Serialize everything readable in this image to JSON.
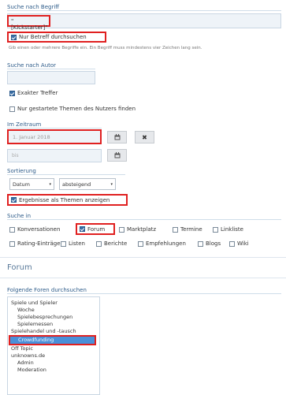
{
  "search": {
    "term_label": "Suche nach Begriff",
    "term_value": "\"[Kickstarter]\"",
    "title_only_label": "Nur Betreff durchsuchen",
    "hint": "Gib einen oder mehrere Begriffe ein. Ein Begriff muss mindestens vier Zeichen lang sein.",
    "author_label": "Suche nach Autor",
    "author_value": "",
    "exact_label": "Exakter Treffer",
    "user_threads_label": "Nur gestartete Themen des Nutzers finden"
  },
  "timeframe": {
    "label": "Im Zeitraum",
    "from_value": "1. Januar 2018",
    "to_placeholder": "bis"
  },
  "sort": {
    "label": "Sortierung",
    "field_value": "Datum",
    "order_value": "absteigend",
    "as_threads_label": "Ergebnisse als Themen anzeigen"
  },
  "search_in": {
    "label": "Suche in",
    "row1": [
      {
        "label": "Konversationen",
        "checked": false
      },
      {
        "label": "Forum",
        "checked": true
      },
      {
        "label": "Marktplatz",
        "checked": false
      },
      {
        "label": "Termine",
        "checked": false
      },
      {
        "label": "Linkliste",
        "checked": false
      }
    ],
    "row2": [
      {
        "label": "Rating-Einträge",
        "checked": false
      },
      {
        "label": "Listen",
        "checked": false
      },
      {
        "label": "Berichte",
        "checked": false
      },
      {
        "label": "Empfehlungen",
        "checked": false
      },
      {
        "label": "Blogs",
        "checked": false
      },
      {
        "label": "Wiki",
        "checked": false
      }
    ]
  },
  "forum": {
    "section_title": "Forum",
    "tree_label": "Folgende Foren durchsuchen",
    "tree": [
      {
        "label": "Spiele und Spieler",
        "indent": 0
      },
      {
        "label": "Woche",
        "indent": 1
      },
      {
        "label": "Spielebesprechungen",
        "indent": 1
      },
      {
        "label": "Spielemessen",
        "indent": 1
      },
      {
        "label": "Spielehandel und -tausch",
        "indent": 0
      },
      {
        "label": "Crowdfunding",
        "indent": 1,
        "selected": true
      },
      {
        "label": "Off Topic",
        "indent": 0
      },
      {
        "label": "unknowns.de",
        "indent": 0
      },
      {
        "label": "Admin",
        "indent": 1
      },
      {
        "label": "Moderation",
        "indent": 1
      }
    ]
  },
  "icons": {
    "calendar": "calendar-icon",
    "clear": "close-icon"
  },
  "colors": {
    "highlight": "#e02020",
    "accent": "#3a6ea5",
    "label": "#2e5c8a",
    "selected_row": "#4a90d9"
  }
}
